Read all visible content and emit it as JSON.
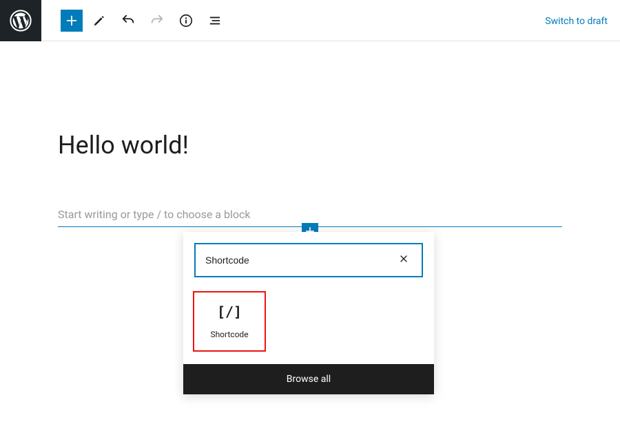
{
  "header": {
    "switch_to_draft_label": "Switch to draft"
  },
  "editor": {
    "title": "Hello world!",
    "block_placeholder": "Start writing or type / to choose a block"
  },
  "inserter": {
    "search_value": "Shortcode",
    "results": [
      {
        "label": "Shortcode",
        "icon_glyph": "[/]"
      }
    ],
    "browse_all_label": "Browse all"
  },
  "colors": {
    "primary": "#007cba",
    "highlight": "#e11"
  }
}
